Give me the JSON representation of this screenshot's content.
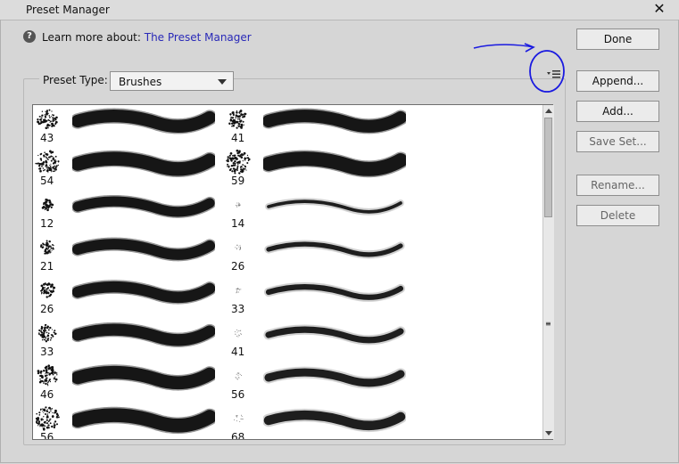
{
  "window": {
    "title": "Preset Manager",
    "close_glyph": "✕"
  },
  "help": {
    "prefix": "Learn more about:",
    "link": "The Preset Manager"
  },
  "preset_type": {
    "label": "Preset Type:",
    "selected": "Brushes"
  },
  "buttons": {
    "done": "Done",
    "append": "Append...",
    "add": "Add...",
    "save_set": "Save Set...",
    "rename": "Rename...",
    "delete": "Delete"
  },
  "brushes": {
    "left": [
      {
        "size": "43",
        "kind": "spatter"
      },
      {
        "size": "54",
        "kind": "spatter"
      },
      {
        "size": "12",
        "kind": "spatter"
      },
      {
        "size": "21",
        "kind": "spatter"
      },
      {
        "size": "26",
        "kind": "spatter"
      },
      {
        "size": "33",
        "kind": "spatter"
      },
      {
        "size": "46",
        "kind": "spatter"
      },
      {
        "size": "56",
        "kind": "spatter"
      }
    ],
    "right": [
      {
        "size": "41",
        "kind": "spatter"
      },
      {
        "size": "59",
        "kind": "spatter"
      },
      {
        "size": "14",
        "kind": "airbrush"
      },
      {
        "size": "26",
        "kind": "airbrush"
      },
      {
        "size": "33",
        "kind": "airbrush"
      },
      {
        "size": "41",
        "kind": "airbrush"
      },
      {
        "size": "56",
        "kind": "airbrush"
      },
      {
        "size": "68",
        "kind": "airbrush"
      }
    ]
  },
  "icons": {
    "help": "help-icon",
    "flyout": "flyout-menu-icon",
    "dropdown": "chevron-down-icon"
  },
  "colors": {
    "link": "#2a2ab8",
    "annotation": "#1a1ae0"
  }
}
